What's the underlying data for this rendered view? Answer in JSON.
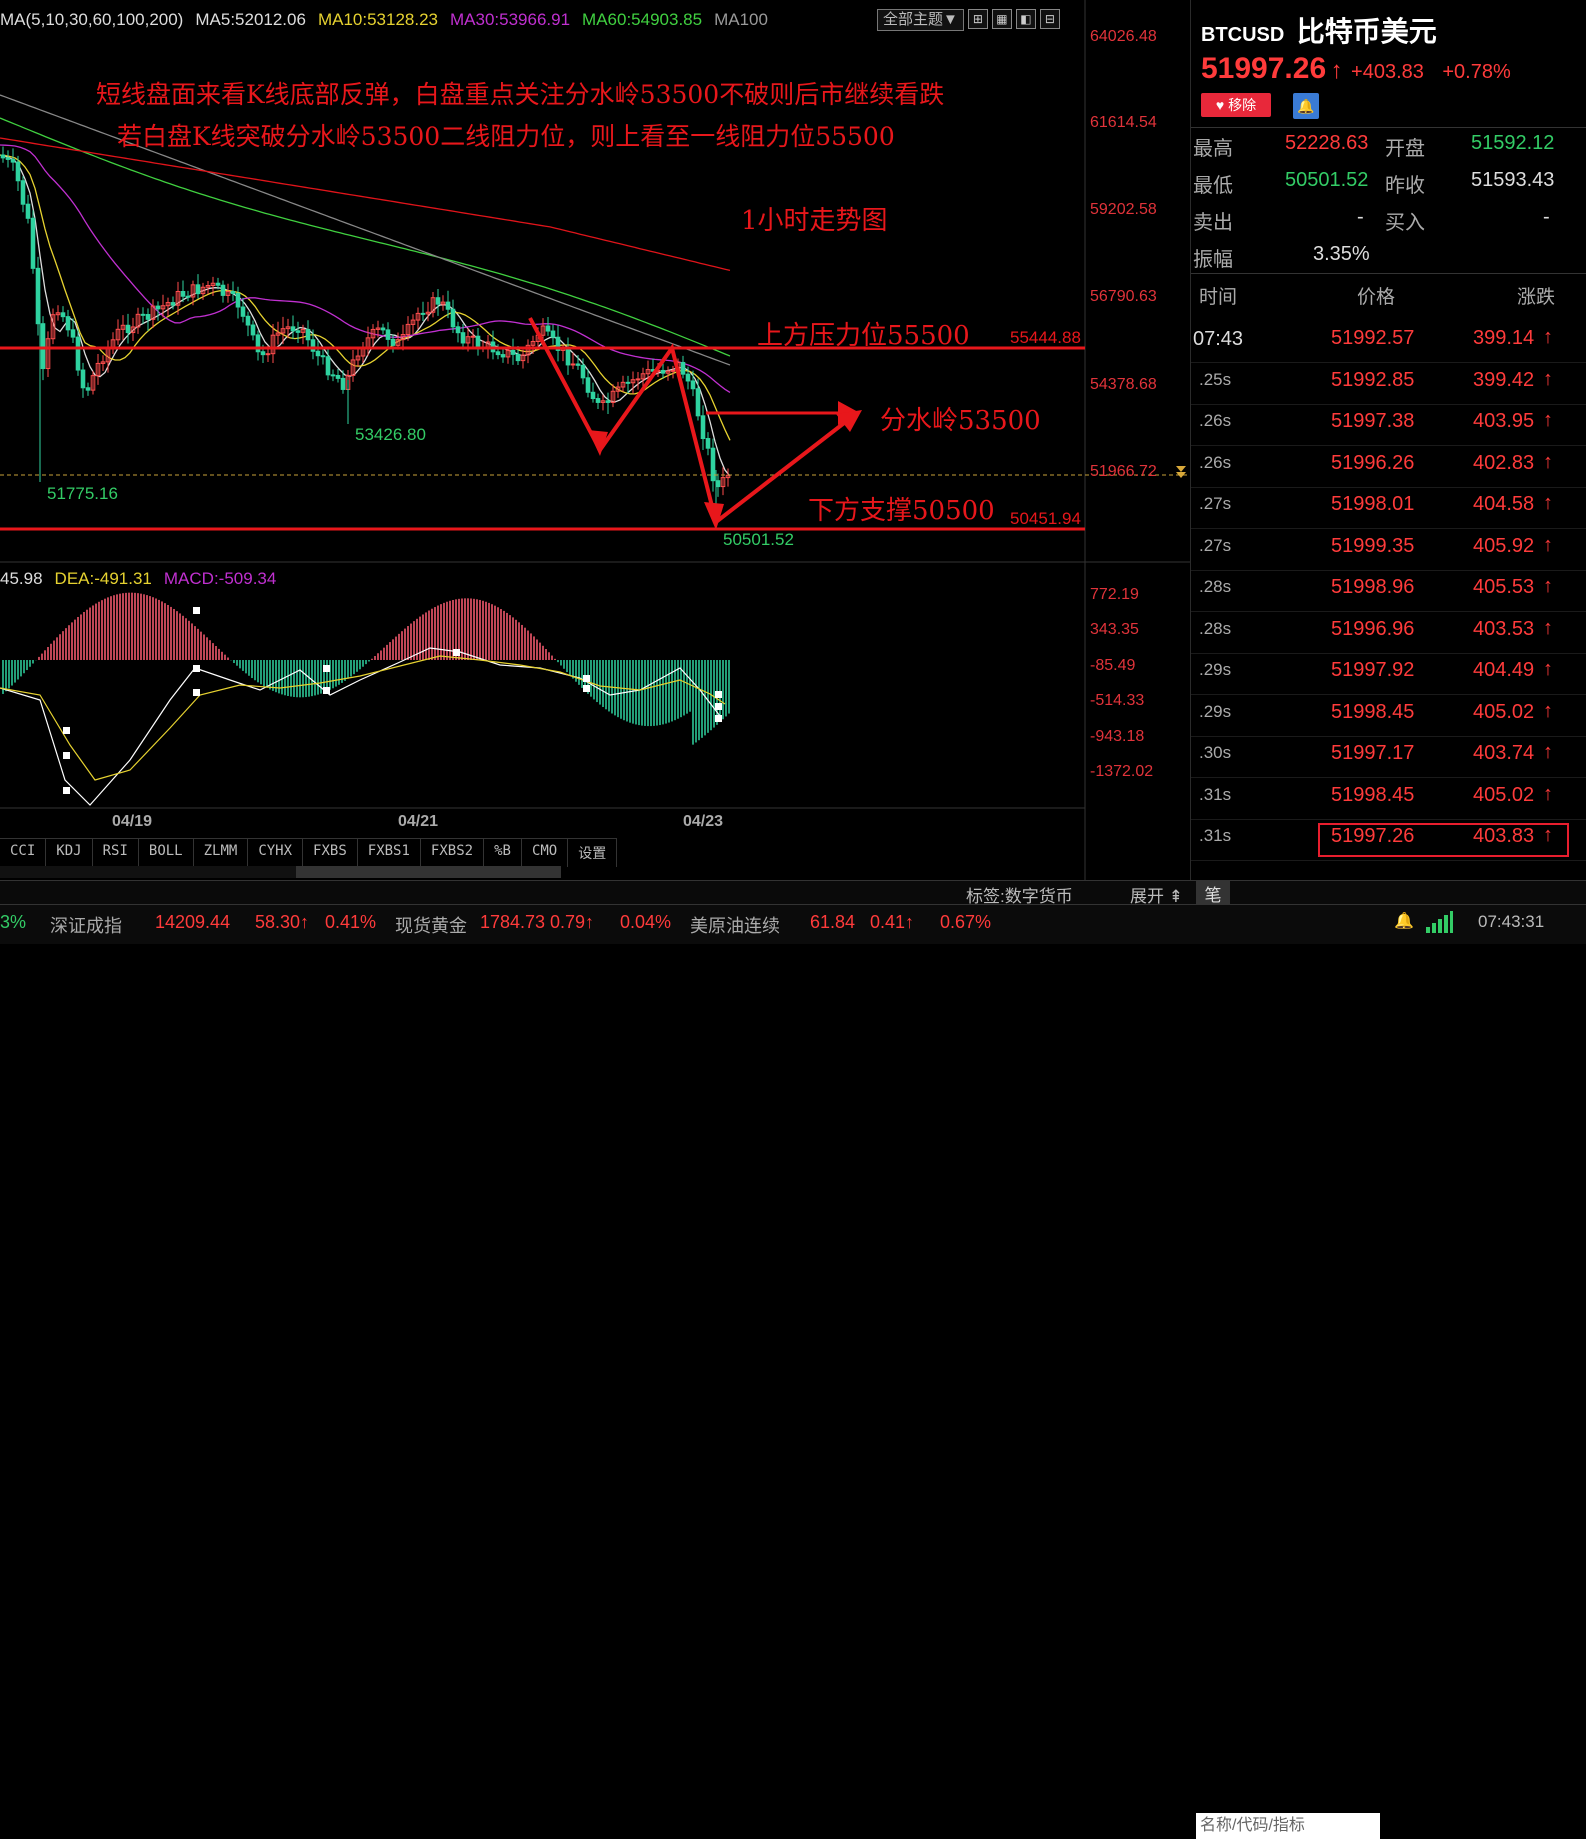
{
  "ma_legend": {
    "params": "MA(5,10,30,60,100,200)",
    "ma5": "MA5:52012.06",
    "ma10": "MA10:53128.23",
    "ma30": "MA30:53966.91",
    "ma60": "MA60:54903.85",
    "ma100": "MA100"
  },
  "toolbar": {
    "theme_select": "全部主题▼",
    "icons": [
      "layout-icon",
      "grid-icon",
      "chart-icon",
      "expand-icon"
    ]
  },
  "price_axis": [
    "64026.48",
    "61614.54",
    "59202.58",
    "56790.63",
    "54378.68",
    "51966.72"
  ],
  "price_levels": {
    "resistance_value": "55444.88",
    "support_value": "50451.94",
    "current_value": "51966.72"
  },
  "chart_labels": {
    "low1": "51775.16",
    "low2": "53426.80",
    "low3": "50501.52"
  },
  "annotations": {
    "line1": "短线盘面来看K线底部反弹，白盘重点关注分水岭53500不破则后市继续看跌",
    "line2": "若白盘K线突破分水岭53500二线阻力位，则上看至一线阻力位55500",
    "timeframe": "1小时走势图",
    "resistance": "上方压力位55500",
    "watershed": "分水岭53500",
    "support": "下方支撑50500"
  },
  "macd_legend": {
    "dif": "45.98",
    "dea": "DEA:-491.31",
    "macd": "MACD:-509.34"
  },
  "macd_axis": [
    "772.19",
    "343.35",
    "-85.49",
    "-514.33",
    "-943.18",
    "-1372.02"
  ],
  "dates": [
    "04/19",
    "04/21",
    "04/23"
  ],
  "indicator_tabs": [
    "CCI",
    "KDJ",
    "RSI",
    "BOLL",
    "ZLMM",
    "CYHX",
    "FXBS",
    "FXBS1",
    "FXBS2",
    "%B",
    "CMO",
    "设置"
  ],
  "quote": {
    "symbol": "BTCUSD",
    "name": "比特币美元",
    "price": "51997.26",
    "arrow": "↑",
    "change": "+403.83",
    "change_pct": "+0.78%",
    "remove_label": "移除"
  },
  "stats": {
    "high_label": "最高",
    "high": "52228.63",
    "open_label": "开盘",
    "open": "51592.12",
    "low_label": "最低",
    "low": "50501.52",
    "prev_label": "昨收",
    "prev": "51593.43",
    "sell_label": "卖出",
    "sell": "-",
    "buy_label": "买入",
    "buy": "-",
    "amp_label": "振幅",
    "amp": "3.35%"
  },
  "tick_header": {
    "time": "时间",
    "price": "价格",
    "change": "涨跌"
  },
  "ticks": [
    {
      "time": "07:43",
      "price": "51992.57",
      "change": "399.14"
    },
    {
      "time": ".25s",
      "price": "51992.85",
      "change": "399.42"
    },
    {
      "time": ".26s",
      "price": "51997.38",
      "change": "403.95"
    },
    {
      "time": ".26s",
      "price": "51996.26",
      "change": "402.83"
    },
    {
      "time": ".27s",
      "price": "51998.01",
      "change": "404.58"
    },
    {
      "time": ".27s",
      "price": "51999.35",
      "change": "405.92"
    },
    {
      "time": ".28s",
      "price": "51998.96",
      "change": "405.53"
    },
    {
      "time": ".28s",
      "price": "51996.96",
      "change": "403.53"
    },
    {
      "time": ".29s",
      "price": "51997.92",
      "change": "404.49"
    },
    {
      "time": ".29s",
      "price": "51998.45",
      "change": "405.02"
    },
    {
      "time": ".30s",
      "price": "51997.17",
      "change": "403.74"
    },
    {
      "time": ".31s",
      "price": "51998.45",
      "change": "405.02"
    },
    {
      "time": ".31s",
      "price": "51997.26",
      "change": "403.83"
    }
  ],
  "footer": {
    "tag": "标签:数字货币",
    "expand": "展开",
    "pen": "笔",
    "ticker": [
      {
        "text": "3%",
        "color": "#33cc66"
      },
      {
        "text": "深证成指",
        "color": "#aaaaaa"
      },
      {
        "text": "14209.44",
        "color": "#ff3b3b"
      },
      {
        "text": "58.30↑",
        "color": "#ff3b3b"
      },
      {
        "text": "0.41%",
        "color": "#ff3b3b"
      },
      {
        "text": "现货黄金",
        "color": "#aaaaaa"
      },
      {
        "text": "1784.73",
        "color": "#ff3b3b"
      },
      {
        "text": "0.79↑",
        "color": "#ff3b3b"
      },
      {
        "text": "0.04%",
        "color": "#ff3b3b"
      },
      {
        "text": "美原油连续",
        "color": "#aaaaaa"
      },
      {
        "text": "61.84",
        "color": "#ff3b3b"
      },
      {
        "text": "0.41↑",
        "color": "#ff3b3b"
      },
      {
        "text": "0.67%",
        "color": "#ff3b3b"
      }
    ],
    "search_placeholder": "名称/代码/指标",
    "clock": "07:43:31"
  }
}
